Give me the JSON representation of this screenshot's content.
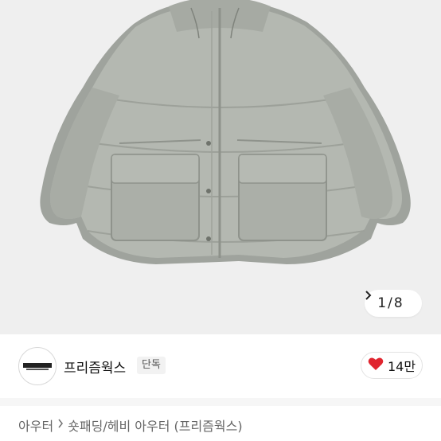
{
  "gallery": {
    "current": "1",
    "separator": "/",
    "total": "8",
    "next_icon": "chevron-right-icon",
    "product_image": "grey-padded-jacket"
  },
  "brand": {
    "logo_text": "FREEZMOWRKS",
    "name": "프리즘웍스",
    "badge": "단독"
  },
  "like": {
    "icon": "heart-icon",
    "color": "#e0252f",
    "count": "14만"
  },
  "breadcrumb": {
    "category": "아우터",
    "separator_icon": "chevron-right-icon",
    "subcategory": "숏패딩/헤비 아우터 (프리즘웍스)"
  }
}
